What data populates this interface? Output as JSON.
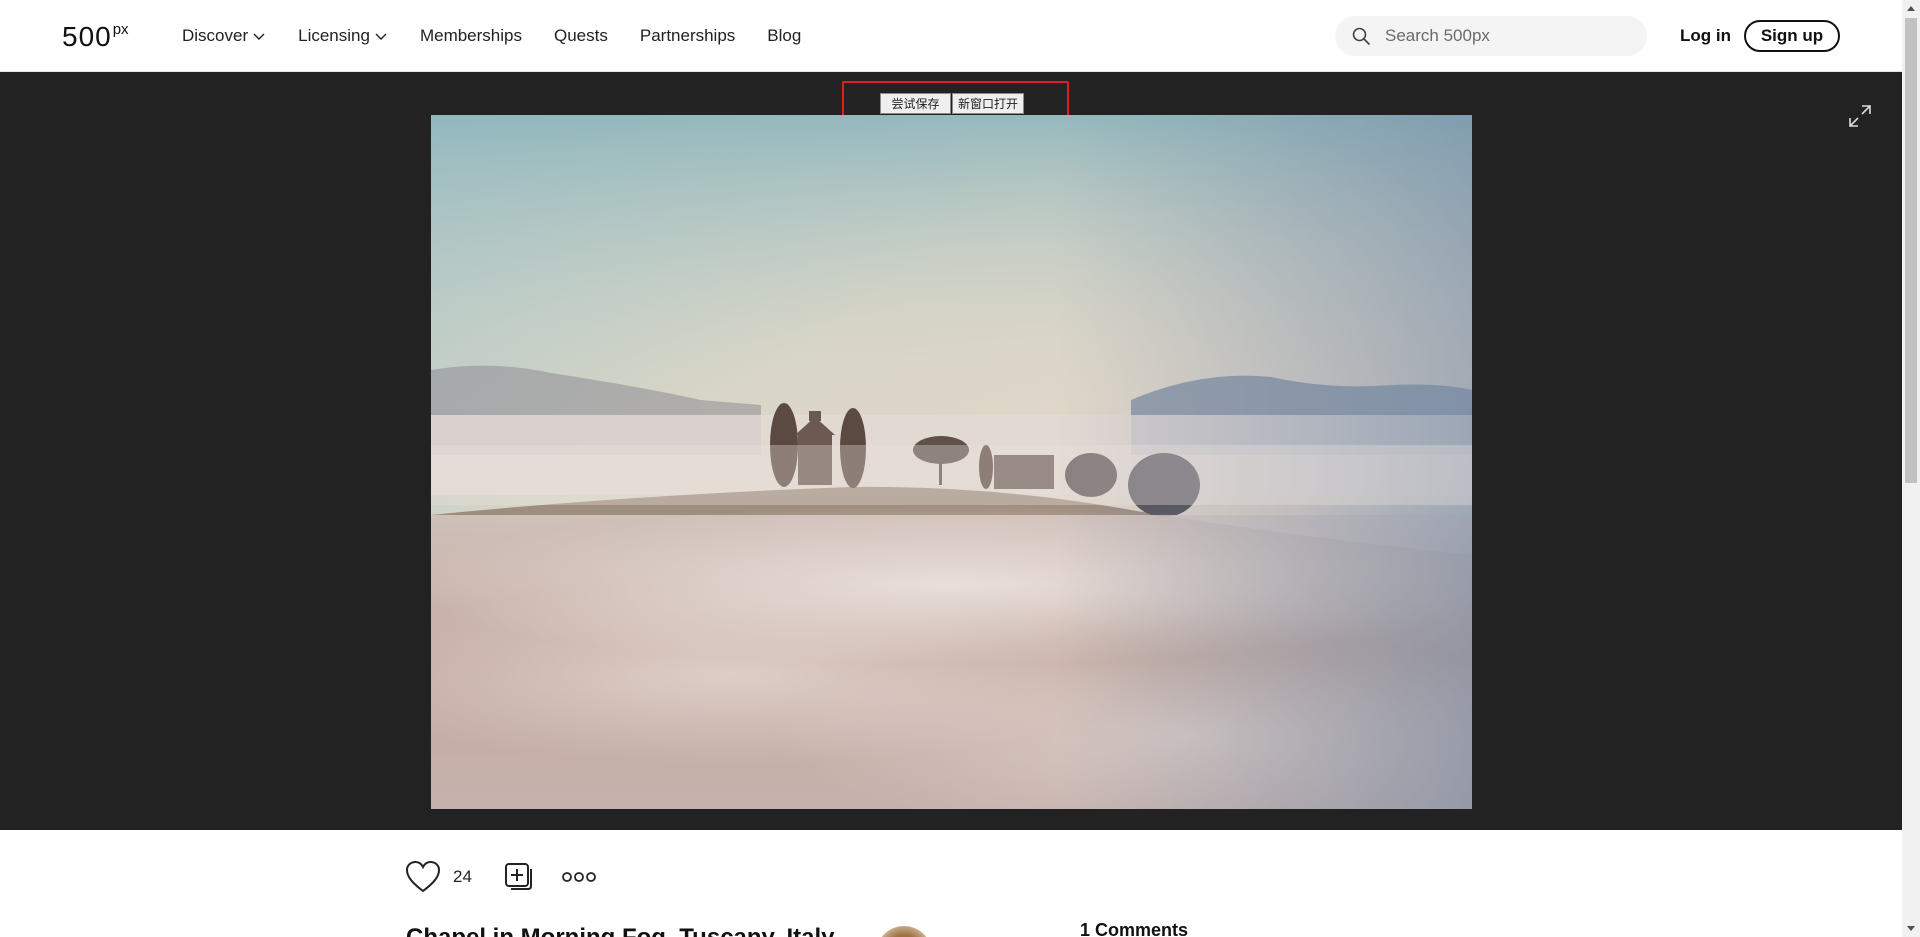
{
  "header": {
    "logo_main": "500",
    "logo_sup": "px",
    "nav": [
      {
        "label": "Discover",
        "has_dropdown": true
      },
      {
        "label": "Licensing",
        "has_dropdown": true
      },
      {
        "label": "Memberships",
        "has_dropdown": false
      },
      {
        "label": "Quests",
        "has_dropdown": false
      },
      {
        "label": "Partnerships",
        "has_dropdown": false
      },
      {
        "label": "Blog",
        "has_dropdown": false
      }
    ],
    "search_placeholder": "Search 500px",
    "login_label": "Log in",
    "signup_label": "Sign up"
  },
  "viewer": {
    "overlay_buttons": [
      "尝试保存",
      "新窗口打开"
    ],
    "expand_icon": "expand-icon",
    "background": "#222222"
  },
  "photo_actions": {
    "like_count": "24",
    "icons": [
      "heart-icon",
      "add-to-gallery-icon",
      "more-options-icon"
    ]
  },
  "photo_info": {
    "title": "Chapel in Morning Fog, Tuscany, Italy",
    "comments_heading": "1 Comments"
  },
  "colors": {
    "overlay_border": "#e02020",
    "text": "#222222",
    "search_bg": "#f4f4f5"
  }
}
